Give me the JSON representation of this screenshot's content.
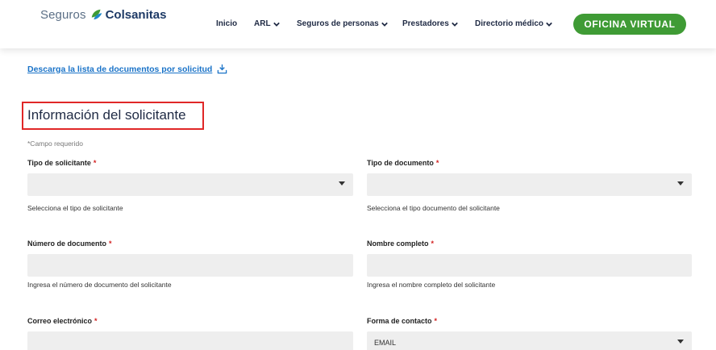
{
  "header": {
    "logo_prefix": "Seguros",
    "logo_brand": "Colsanitas",
    "nav": [
      {
        "label": "Inicio",
        "has_dropdown": false
      },
      {
        "label": "ARL",
        "has_dropdown": true
      },
      {
        "label": "Seguros de personas",
        "has_dropdown": true
      },
      {
        "label": "Prestadores",
        "has_dropdown": true
      },
      {
        "label": "Directorio médico",
        "has_dropdown": true
      }
    ],
    "cta_label": "OFICINA VIRTUAL"
  },
  "download_link": "Descarga la lista de documentos por solicitud",
  "section_title": "Información del solicitante",
  "required_note": "*Campo requerido",
  "required_marker": "*",
  "fields": {
    "tipo_solicitante": {
      "label": "Tipo de solicitante",
      "help": "Selecciona el tipo de solicitante",
      "value": ""
    },
    "tipo_documento": {
      "label": "Tipo de documento",
      "help": "Selecciona el tipo documento del solicitante",
      "value": ""
    },
    "numero_documento": {
      "label": "Número de documento",
      "help": "Ingresa el número de documento del solicitante",
      "value": ""
    },
    "nombre_completo": {
      "label": "Nombre completo",
      "help": "Ingresa el nombre completo del solicitante",
      "value": ""
    },
    "correo": {
      "label": "Correo electrónico",
      "value": ""
    },
    "forma_contacto": {
      "label": "Forma de contacto",
      "value": "EMAIL"
    }
  },
  "colors": {
    "brand_green": "#3f9b35",
    "link_blue": "#1a73c8",
    "highlight_red": "#e02727",
    "field_bg": "#eeeeee"
  }
}
